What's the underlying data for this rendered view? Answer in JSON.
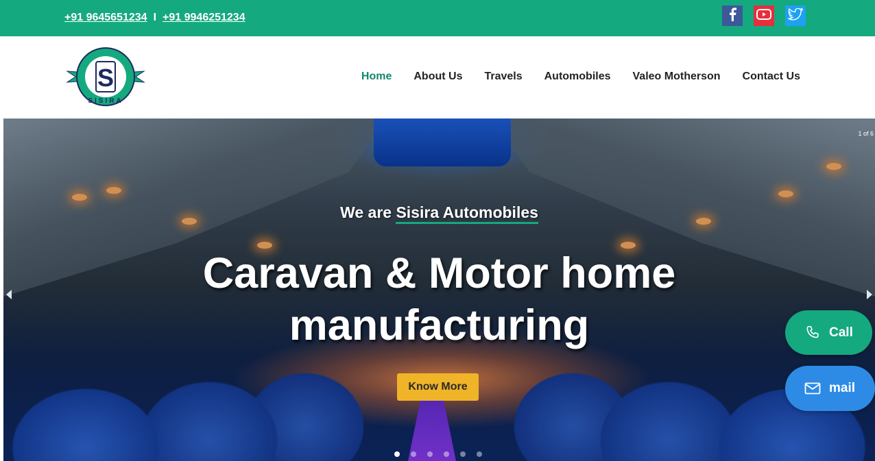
{
  "topbar": {
    "phone_1": "+91 9645651234",
    "separator": "I",
    "phone_2": "+91 9946251234",
    "socials": [
      {
        "name": "facebook-icon",
        "color": "#3b5998"
      },
      {
        "name": "youtube-icon",
        "color": "#e62e3d"
      },
      {
        "name": "twitter-icon",
        "color": "#1da1f2"
      }
    ],
    "bg_color": "#15a97f"
  },
  "header": {
    "logo_letter": "S",
    "logo_text": "SISIRA",
    "nav": [
      {
        "label": "Home",
        "active": true
      },
      {
        "label": "About Us",
        "active": false
      },
      {
        "label": "Travels",
        "active": false
      },
      {
        "label": "Automobiles",
        "active": false
      },
      {
        "label": "Valeo Motherson",
        "active": false
      },
      {
        "label": "Contact Us",
        "active": false
      }
    ],
    "active_color": "#12866a"
  },
  "hero": {
    "slide_counter": "1 of 6",
    "tagline_prefix": "We are ",
    "tagline_brand": "Sisira Automobiles",
    "headline_line1": "Caravan & Motor home",
    "headline_line2": "manufacturing",
    "cta_label": "Know More",
    "cta_color": "#f0b428",
    "dots_count": 6,
    "active_dot": 0
  },
  "floating": {
    "call_label": "Call",
    "mail_label": "mail",
    "call_color": "#15a97f",
    "mail_color": "#2d8be6"
  }
}
